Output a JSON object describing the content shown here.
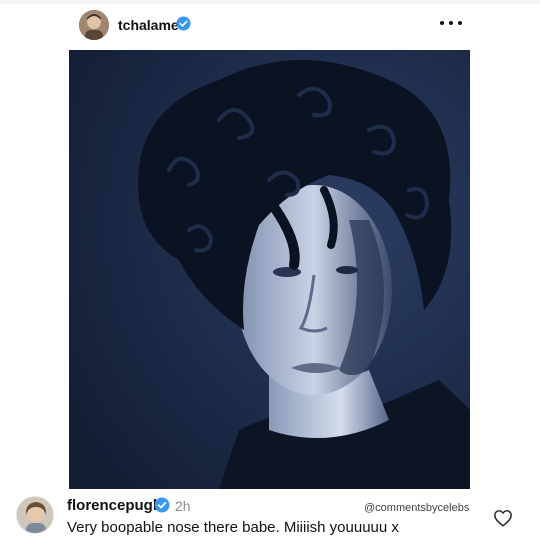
{
  "post": {
    "username": "tchalamet",
    "verified": true,
    "more_icon": "more-horizontal-icon"
  },
  "comment": {
    "username": "florencepugh",
    "verified": true,
    "time": "2h",
    "text": "Very boopable nose there babe. Miiiish youuuuu x",
    "like_icon": "heart-outline-icon"
  },
  "watermark": "@commentsbycelebs",
  "colors": {
    "verified_blue": "#3897f0",
    "image_tint": "#1c2b48",
    "meta_gray": "#8e8e8e"
  }
}
